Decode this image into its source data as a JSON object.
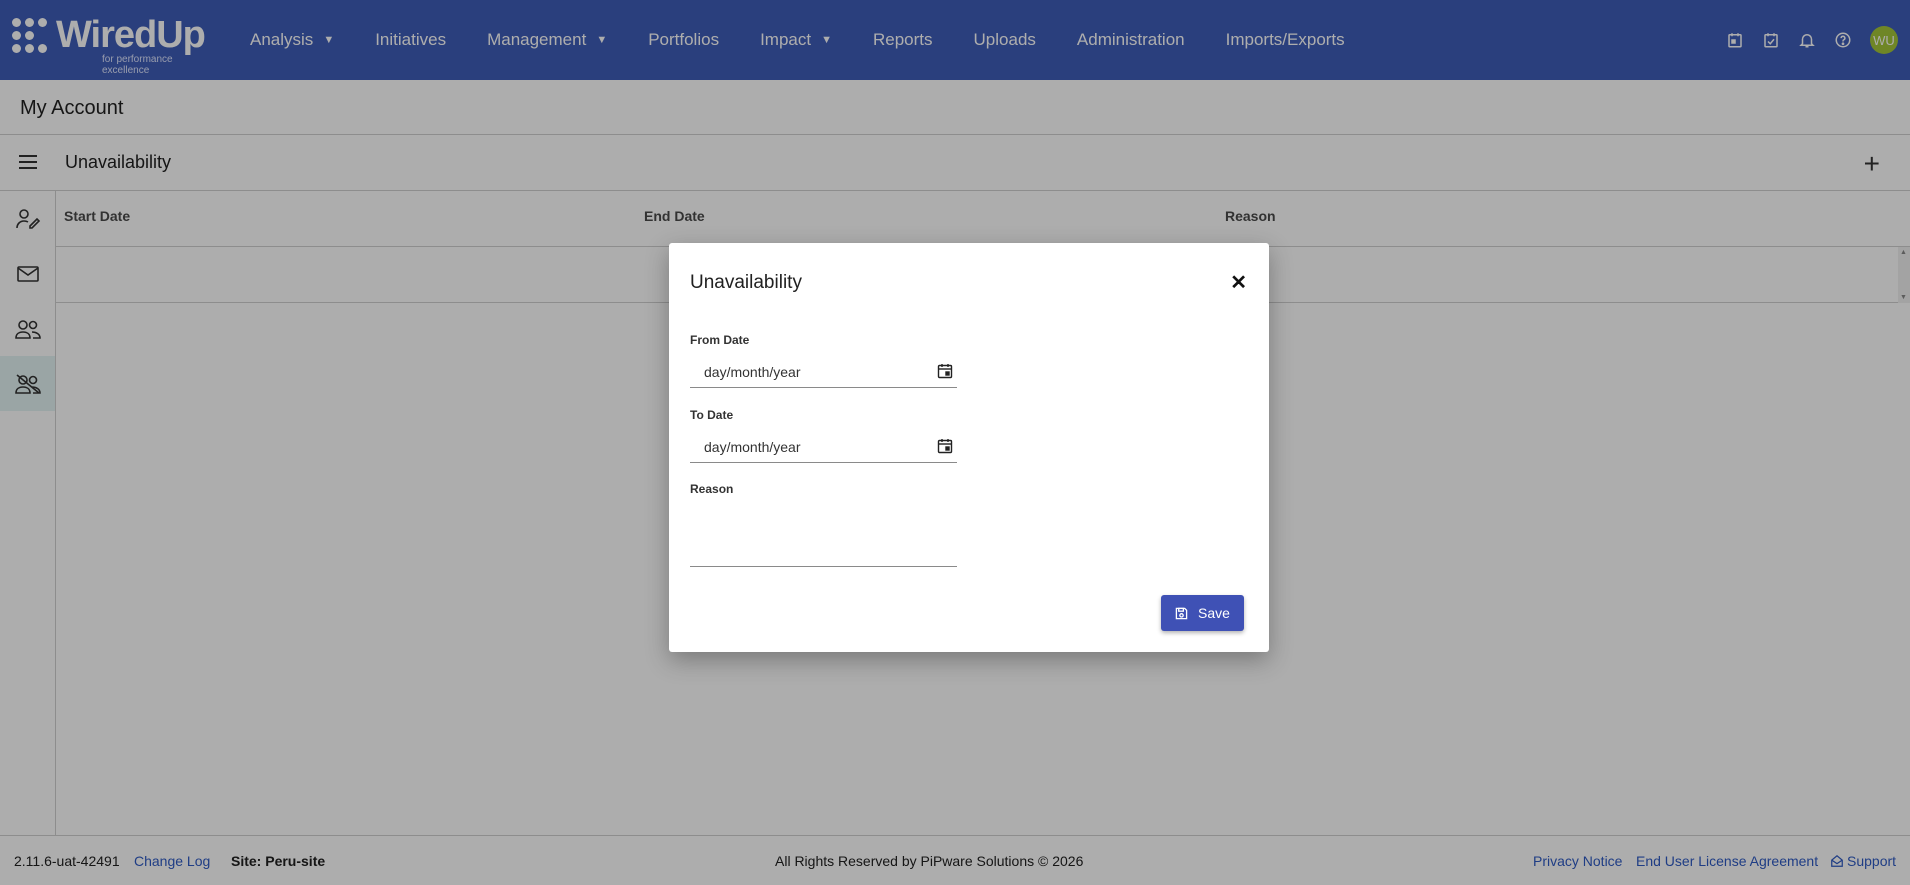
{
  "brand": {
    "name": "WiredUp",
    "tagline": "for performance excellence"
  },
  "nav": [
    {
      "label": "Analysis",
      "dropdown": true
    },
    {
      "label": "Initiatives",
      "dropdown": false
    },
    {
      "label": "Management",
      "dropdown": true
    },
    {
      "label": "Portfolios",
      "dropdown": false
    },
    {
      "label": "Impact",
      "dropdown": true
    },
    {
      "label": "Reports",
      "dropdown": false
    },
    {
      "label": "Uploads",
      "dropdown": false
    },
    {
      "label": "Administration",
      "dropdown": false
    },
    {
      "label": "Imports/Exports",
      "dropdown": false
    }
  ],
  "top_icons": [
    "calendar-icon",
    "calendar-check-icon",
    "bell-icon",
    "help-icon"
  ],
  "user": {
    "initials": "WU"
  },
  "page": {
    "title": "My Account"
  },
  "section": {
    "title": "Unavailability"
  },
  "side_rail": [
    "user-edit-icon",
    "mail-icon",
    "users-icon",
    "user-off-icon"
  ],
  "table": {
    "columns": [
      "Start Date",
      "End Date",
      "Reason"
    ],
    "rows": []
  },
  "dialog": {
    "title": "Unavailability",
    "from_label": "From Date",
    "from_placeholder": "day/month/year",
    "to_label": "To Date",
    "to_placeholder": "day/month/year",
    "reason_label": "Reason",
    "reason_value": "",
    "save_label": "Save"
  },
  "footer": {
    "version": "2.11.6-uat-42491",
    "changelog": "Change Log",
    "site": "Site: Peru-site",
    "rights": "All Rights Reserved by PiPware Solutions © 2026",
    "privacy": "Privacy Notice",
    "eula": "End User License Agreement",
    "support": "Support"
  },
  "colors": {
    "topbar": "#3f5db8",
    "primary_button": "#3f51b5",
    "avatar": "#a4c639",
    "link": "#2f5bc4"
  }
}
